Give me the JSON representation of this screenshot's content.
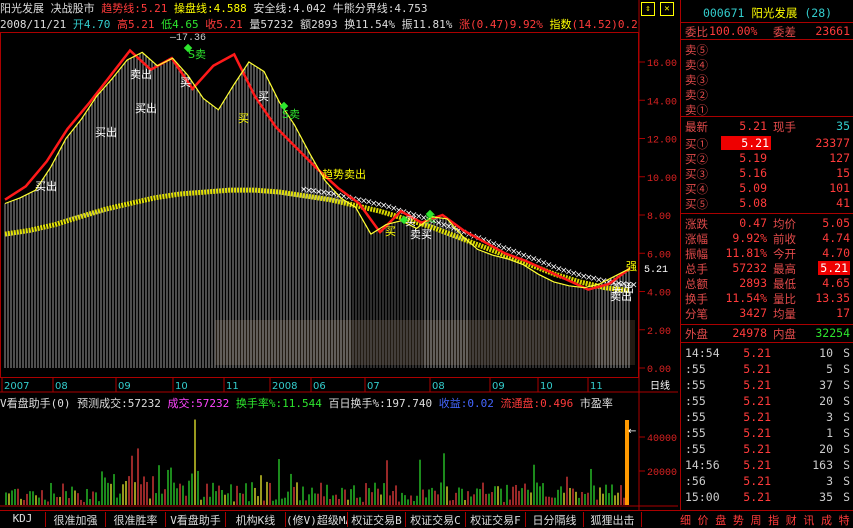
{
  "header": {
    "stock_name": "阳光发展",
    "tool": "决战股市",
    "trend_label": "趋势线:",
    "trend_val": "5.21",
    "op_label": "操盘线:",
    "op_val": "4.588",
    "safe_label": "安全线:",
    "safe_val": "4.042",
    "bull_label": "牛熊分界线:",
    "bull_val": "4.753",
    "date": "2008/11/21",
    "open_label": "开",
    "open": "4.70",
    "high_label": "高",
    "high": "5.21",
    "low_label": "低",
    "low": "4.65",
    "close_label": "收",
    "close": "5.21",
    "vol_label": "量",
    "vol": "57232",
    "amt_label": "额",
    "amt": "2893",
    "turn_label": "换",
    "turn": "11.54%",
    "amp_label": "振",
    "amp": "11.81%",
    "chg_label": "涨",
    "chg": "(0.47)",
    "chg_pct": "9.92%",
    "idx_label": "指数",
    "idx": "(14.52)",
    "idx_pct": "0.2"
  },
  "chart_data": {
    "type": "line",
    "ylim": [
      0,
      17
    ],
    "y_ticks": [
      "16.00",
      "14.00",
      "12.00",
      "10.00",
      "8.00",
      "6.00",
      "4.00",
      "2.00",
      "0.00"
    ],
    "x_labels": [
      "2007",
      "08",
      "09",
      "10",
      "11",
      "2008",
      "06",
      "07",
      "08",
      "09",
      "10",
      "11",
      "日线"
    ],
    "peak_label": "17.36",
    "current_price": "5.21",
    "annotations": [
      "S卖",
      "卖出",
      "买出",
      "买出",
      "买出",
      "买",
      "S卖",
      "趋势卖出",
      "买",
      "买",
      "买",
      "卖",
      "买",
      "卖买",
      "强",
      "卖出",
      "买出"
    ],
    "close_series": [
      8.6,
      8.9,
      9.3,
      10.5,
      12.0,
      13.0,
      14.2,
      15.1,
      16.1,
      16.5,
      15.8,
      16.2,
      15.3,
      14.1,
      13.5,
      14.8,
      16.0,
      15.5,
      13.9,
      12.7,
      11.2,
      9.8,
      8.9,
      8.4,
      7.0,
      7.5,
      7.7,
      7.3,
      7.9,
      7.8,
      6.9,
      6.2,
      5.9,
      5.7,
      5.4,
      4.9,
      4.5,
      4.3,
      4.2,
      4.4,
      4.8,
      5.21
    ],
    "trend_series": [
      8.8,
      9.5,
      10.8,
      12.5,
      13.8,
      15.2,
      16.6,
      15.6,
      16.2,
      14.6,
      15.8,
      16.4,
      14.2,
      12.6,
      11.5,
      10.4,
      9.4,
      8.6,
      7.1,
      8.2,
      7.6,
      8.0,
      7.2,
      6.6,
      6.0,
      5.6,
      5.1,
      4.6,
      4.1,
      4.4,
      5.21
    ],
    "safe_series": [
      7.0,
      7.2,
      7.5,
      7.9,
      8.3,
      8.6,
      8.9,
      9.1,
      9.2,
      9.3,
      9.3,
      9.2,
      9.0,
      8.8,
      8.5,
      8.2,
      7.8,
      7.4,
      6.9,
      6.4,
      5.9,
      5.4,
      4.9,
      4.5,
      4.2,
      4.04
    ],
    "volume_y_ticks": [
      "40000",
      "20000"
    ],
    "volume_max": 50000
  },
  "indicator": {
    "title": "V看盘助手",
    "param": "(0)",
    "pred_label": "预测成交:",
    "pred": "57232",
    "vol_label": "成交:",
    "vol": "57232",
    "turn_label": "换手率%:",
    "turn": "11.544",
    "hundred_label": "百日换手%:",
    "hundred": "197.740",
    "gain_label": "收益:",
    "gain": "0.02",
    "float_label": "流通盘:",
    "float": "0.496",
    "pe_label": "市盈率"
  },
  "quote": {
    "code": "000671",
    "name": "阳光发展",
    "num": "(28)",
    "wb_label": "委比",
    "wb": "100.00%",
    "wc_label": "委差",
    "wc": "23661",
    "sells": [
      {
        "label": "卖⑤",
        "price": "",
        "vol": ""
      },
      {
        "label": "卖④",
        "price": "",
        "vol": ""
      },
      {
        "label": "卖③",
        "price": "",
        "vol": ""
      },
      {
        "label": "卖②",
        "price": "",
        "vol": ""
      },
      {
        "label": "卖①",
        "price": "",
        "vol": ""
      }
    ],
    "latest_label": "最新",
    "latest": "5.21",
    "cur_label": "现手",
    "cur": "35",
    "buys": [
      {
        "label": "买①",
        "price": "5.21",
        "vol": "23377"
      },
      {
        "label": "买②",
        "price": "5.19",
        "vol": "127"
      },
      {
        "label": "买③",
        "price": "5.16",
        "vol": "15"
      },
      {
        "label": "买④",
        "price": "5.09",
        "vol": "101"
      },
      {
        "label": "买⑤",
        "price": "5.08",
        "vol": "41"
      }
    ],
    "stats": [
      {
        "l1": "涨跌",
        "v1": "0.47",
        "l2": "均价",
        "v2": "5.05"
      },
      {
        "l1": "涨幅",
        "v1": "9.92%",
        "l2": "前收",
        "v2": "4.74"
      },
      {
        "l1": "振幅",
        "v1": "11.81%",
        "l2": "今开",
        "v2": "4.70"
      },
      {
        "l1": "总手",
        "v1": "57232",
        "l2": "最高",
        "v2": "5.21"
      },
      {
        "l1": "总额",
        "v1": "2893",
        "l2": "最低",
        "v2": "4.65"
      },
      {
        "l1": "换手",
        "v1": "11.54%",
        "l2": "量比",
        "v2": "13.35"
      },
      {
        "l1": "分笔",
        "v1": "3427",
        "l2": "均量",
        "v2": "17"
      }
    ],
    "outer_label": "外盘",
    "outer": "24978",
    "inner_label": "内盘",
    "inner": "32254",
    "ticks": [
      {
        "t": "14:54",
        "p": "5.21",
        "v": "10",
        "s": "S"
      },
      {
        "t": ":55",
        "p": "5.21",
        "v": "5",
        "s": "S"
      },
      {
        "t": ":55",
        "p": "5.21",
        "v": "37",
        "s": "S"
      },
      {
        "t": ":55",
        "p": "5.21",
        "v": "20",
        "s": "S"
      },
      {
        "t": ":55",
        "p": "5.21",
        "v": "3",
        "s": "S"
      },
      {
        "t": ":55",
        "p": "5.21",
        "v": "1",
        "s": "S"
      },
      {
        "t": ":55",
        "p": "5.21",
        "v": "20",
        "s": "S"
      },
      {
        "t": "14:56",
        "p": "5.21",
        "v": "163",
        "s": "S"
      },
      {
        "t": ":56",
        "p": "5.21",
        "v": "3",
        "s": "S"
      },
      {
        "t": "15:00",
        "p": "5.21",
        "v": "35",
        "s": "S"
      }
    ]
  },
  "tabs": [
    "KDJ",
    "很准加强",
    "很准胜率",
    "V看盘助手",
    "机构K线",
    "(修V)超级MACD",
    "权证交易B",
    "权证交易C",
    "权证交易F",
    "日分隔线",
    "狐狸出击"
  ],
  "footer_right": "细 价 盘 势 周 指 财 讯 成 特 解"
}
